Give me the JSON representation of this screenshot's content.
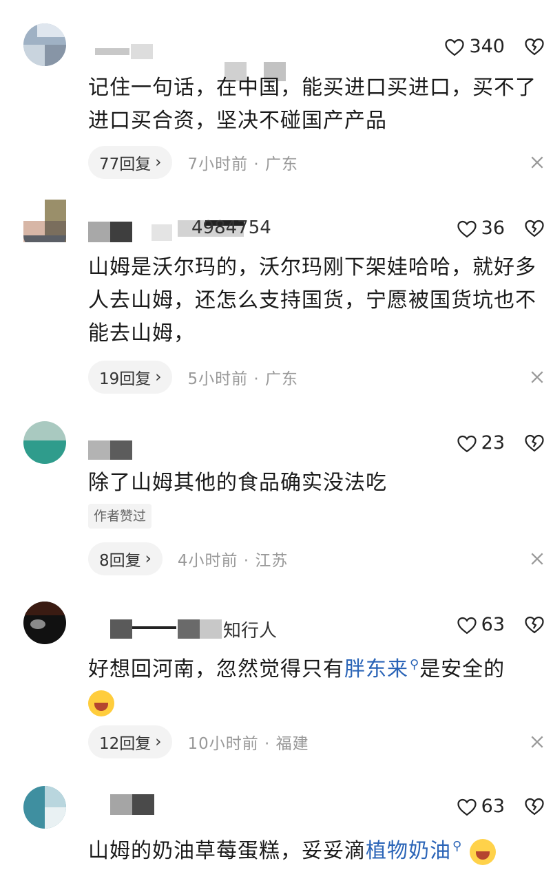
{
  "comments": [
    {
      "name": "",
      "likes": "340",
      "text": "记住一句话，在中国，能买进口买进口，买不了进口买合资，坚决不碰国产产品",
      "replies": "77回复",
      "meta": "7小时前 · 广东"
    },
    {
      "name": "4984754",
      "likes": "36",
      "text": "山姆是沃尔玛的，沃尔玛刚下架娃哈哈，就好多人去山姆，还怎么支持国货，宁愿被国货坑也不能去山姆，",
      "replies": "19回复",
      "meta": "5小时前 · 广东"
    },
    {
      "name": "",
      "likes": "23",
      "text": "除了山姆其他的食品确实没法吃",
      "badge": "作者赞过",
      "replies": "8回复",
      "meta": "4小时前 · 江苏"
    },
    {
      "name": "知行人",
      "likes": "63",
      "text_before": "好想回河南，忽然觉得只有",
      "link": "胖东来",
      "text_after": "是安全的",
      "replies": "12回复",
      "meta": "10小时前 · 福建"
    },
    {
      "name": "",
      "likes": "63",
      "text_before": "山姆的奶油草莓蛋糕，妥妥滴",
      "link": "植物奶油"
    }
  ],
  "icons": {
    "like": "heart-outline-icon",
    "dislike": "broken-heart-icon",
    "reply_chevron": "chevron-right-icon",
    "close": "close-icon",
    "search": "search-icon"
  },
  "colors": {
    "link": "#2a64b7",
    "meta": "#999999",
    "pill": "#f3f3f3"
  }
}
